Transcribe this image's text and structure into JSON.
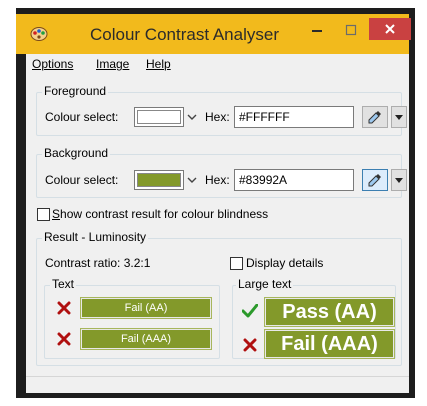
{
  "window": {
    "title": "Colour Contrast Analyser",
    "title_bar_color": "#f2ba1c",
    "close_button_color": "#c94141"
  },
  "menu": {
    "items": [
      {
        "label": "Options",
        "accelerator": "O"
      },
      {
        "label": "Image",
        "accelerator": "I"
      },
      {
        "label": "Help",
        "accelerator": "H"
      }
    ]
  },
  "foreground": {
    "group_label": "Foreground",
    "colour_select_label": "Colour select:",
    "swatch_color": "#FFFFFF",
    "hex_label": "Hex:",
    "hex_value": "#FFFFFF"
  },
  "background": {
    "group_label": "Background",
    "colour_select_label": "Colour select:",
    "swatch_color": "#83992A",
    "hex_label": "Hex:",
    "hex_value": "#83992A"
  },
  "options": {
    "blindness_checkbox_label": "Show contrast result for colour blindness",
    "blindness_checked": false
  },
  "result": {
    "group_label": "Result - Luminosity",
    "contrast_ratio": "Contrast ratio: 3.2:1",
    "display_details_label": "Display details",
    "display_details_checked": false,
    "text_group_label": "Text",
    "large_text_group_label": "Large text",
    "text_results": [
      {
        "label": "Fail (AA)",
        "status": "fail"
      },
      {
        "label": "Fail (AAA)",
        "status": "fail"
      }
    ],
    "large_text_results": [
      {
        "label": "Pass (AA)",
        "status": "pass"
      },
      {
        "label": "Fail (AAA)",
        "status": "fail"
      }
    ],
    "result_bar_color": "#83992a",
    "pass_color": "#2c9a2c",
    "fail_color": "#b01010"
  }
}
